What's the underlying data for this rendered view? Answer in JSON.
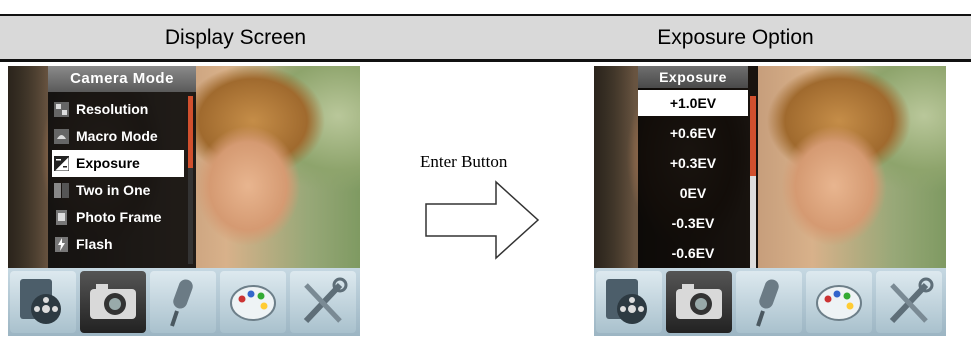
{
  "headers": {
    "left": "Display Screen",
    "right": "Exposure Option"
  },
  "left_screen": {
    "menu_title": "Camera Mode",
    "items": [
      {
        "label": "Resolution",
        "icon": "resolution-icon",
        "selected": false
      },
      {
        "label": "Macro Mode",
        "icon": "macro-icon",
        "selected": false
      },
      {
        "label": "Exposure",
        "icon": "exposure-icon",
        "selected": true
      },
      {
        "label": "Two in One",
        "icon": "two-in-one-icon",
        "selected": false
      },
      {
        "label": "Photo Frame",
        "icon": "photo-frame-icon",
        "selected": false
      },
      {
        "label": "Flash",
        "icon": "flash-icon",
        "selected": false
      }
    ]
  },
  "right_screen": {
    "menu_title": "Exposure",
    "items": [
      {
        "label": "+1.0EV",
        "selected": true
      },
      {
        "label": "+0.6EV",
        "selected": false
      },
      {
        "label": "+0.3EV",
        "selected": false
      },
      {
        "label": "0EV",
        "selected": false
      },
      {
        "label": "-0.3EV",
        "selected": false
      },
      {
        "label": "-0.6EV",
        "selected": false
      }
    ]
  },
  "transition": {
    "label": "Enter Button"
  },
  "iconbar": {
    "icons": [
      "film-reel-icon",
      "camera-icon",
      "microphone-icon",
      "palette-icon",
      "tools-icon"
    ],
    "active_index": 1
  },
  "colors": {
    "accent": "#d1502e",
    "header_bg": "#d9d9d9",
    "menu_bg": "#0c0c0c"
  }
}
